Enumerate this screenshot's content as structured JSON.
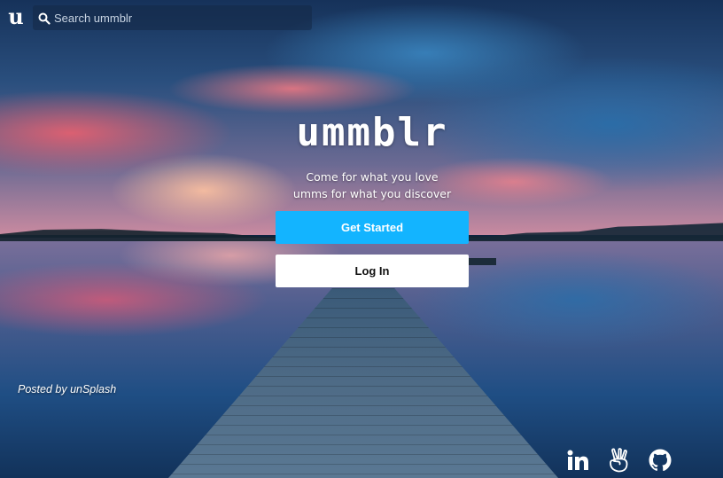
{
  "header": {
    "logo_text": "u",
    "search_placeholder": "Search ummblr"
  },
  "hero": {
    "brand": "ummblr",
    "tagline_line1": "Come for what you love",
    "tagline_line2": "umms for what you discover",
    "get_started_label": "Get Started",
    "login_label": "Log In"
  },
  "footer": {
    "credit": "Posted by unSplash",
    "social_icons": [
      "linkedin-icon",
      "angellist-icon",
      "github-icon"
    ]
  },
  "colors": {
    "primary_button": "#13b4ff",
    "secondary_button": "#ffffff"
  }
}
